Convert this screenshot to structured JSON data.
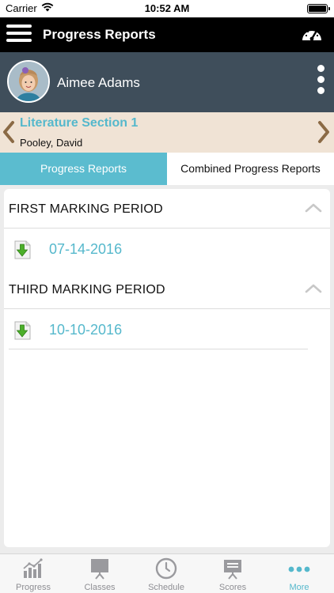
{
  "status_bar": {
    "carrier": "Carrier",
    "time": "10:52 AM"
  },
  "navbar": {
    "title": "Progress Reports"
  },
  "student": {
    "name": "Aimee Adams"
  },
  "class_info": {
    "name": "Literature Section 1",
    "teacher": "Pooley, David"
  },
  "tabs": [
    {
      "label": "Progress Reports",
      "active": true
    },
    {
      "label": "Combined Progress Reports",
      "active": false
    }
  ],
  "sections": [
    {
      "title": "FIRST MARKING PERIOD",
      "reports": [
        {
          "date": "07-14-2016"
        }
      ]
    },
    {
      "title": "THIRD MARKING PERIOD",
      "reports": [
        {
          "date": "10-10-2016"
        }
      ]
    }
  ],
  "tabbar": [
    {
      "label": "Progress",
      "icon": "bar-chart-icon",
      "active": false
    },
    {
      "label": "Classes",
      "icon": "easel-icon",
      "active": false
    },
    {
      "label": "Schedule",
      "icon": "clock-icon",
      "active": false
    },
    {
      "label": "Scores",
      "icon": "scoreboard-icon",
      "active": false
    },
    {
      "label": "More",
      "icon": "more-dots-icon",
      "active": true
    }
  ],
  "colors": {
    "accent": "#55b8cc",
    "navbar_bg": "#000000",
    "student_bar_bg": "#3f4e5b",
    "class_bar_bg": "#f0e3d5",
    "chevron": "#8b6a45",
    "download_green": "#4caf2a"
  }
}
